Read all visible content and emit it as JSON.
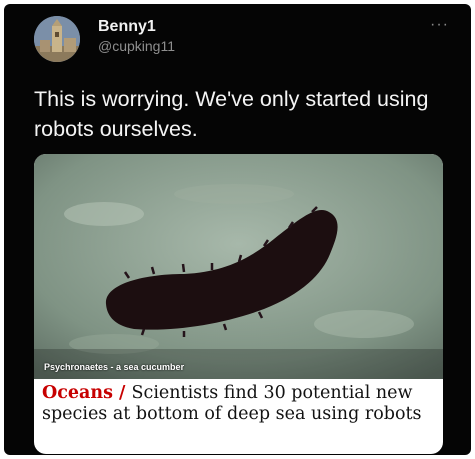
{
  "author": {
    "display_name": "Benny1",
    "handle": "@cupking11",
    "avatar_icon": "church-tower-avatar"
  },
  "more_icon": "···",
  "tweet": {
    "text": "This is worrying. We've only started using robots ourselves."
  },
  "card": {
    "image_caption": "Psychronaetes - a sea cucumber",
    "section": "Oceans",
    "separator": " / ",
    "headline": "Scientists find 30 potential new species at bottom of deep sea using robots"
  },
  "colors": {
    "background": "#050505",
    "section_red": "#c70000",
    "seafloor": "#8a9d8e"
  }
}
